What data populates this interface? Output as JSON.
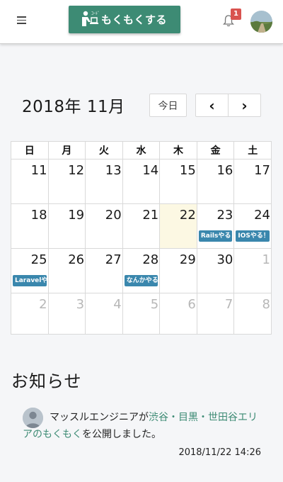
{
  "header": {
    "brand_label": "もくもくする",
    "notification_count": "1",
    "accent_color": "#3d8b74"
  },
  "calendar": {
    "title": "2018年 11月",
    "today_label": "今日",
    "weekdays": [
      "日",
      "月",
      "火",
      "水",
      "木",
      "金",
      "土"
    ],
    "weeks": [
      [
        {
          "day": "11"
        },
        {
          "day": "12"
        },
        {
          "day": "13"
        },
        {
          "day": "14"
        },
        {
          "day": "15"
        },
        {
          "day": "16"
        },
        {
          "day": "17"
        }
      ],
      [
        {
          "day": "18"
        },
        {
          "day": "19"
        },
        {
          "day": "20"
        },
        {
          "day": "21"
        },
        {
          "day": "22",
          "today": true
        },
        {
          "day": "23",
          "event": "Railsやる！"
        },
        {
          "day": "24",
          "event": "IOSやる！"
        }
      ],
      [
        {
          "day": "25",
          "event": "Laravelや"
        },
        {
          "day": "26"
        },
        {
          "day": "27"
        },
        {
          "day": "28",
          "event": "なんかやる"
        },
        {
          "day": "29"
        },
        {
          "day": "30"
        },
        {
          "day": "1",
          "other": true
        }
      ],
      [
        {
          "day": "2",
          "other": true
        },
        {
          "day": "3",
          "other": true
        },
        {
          "day": "4",
          "other": true
        },
        {
          "day": "5",
          "other": true
        },
        {
          "day": "6",
          "other": true
        },
        {
          "day": "7",
          "other": true
        },
        {
          "day": "8",
          "other": true
        }
      ]
    ],
    "event_color": "#3a87ad",
    "today_color": "#fcf8e3"
  },
  "news": {
    "title": "お知らせ",
    "items": [
      {
        "prefix": "マッスルエンジニアが",
        "link": "渋谷・目黒・世田谷エリアのもくもく",
        "suffix": "を公開しました。",
        "time": "2018/11/22 14:26"
      }
    ]
  }
}
